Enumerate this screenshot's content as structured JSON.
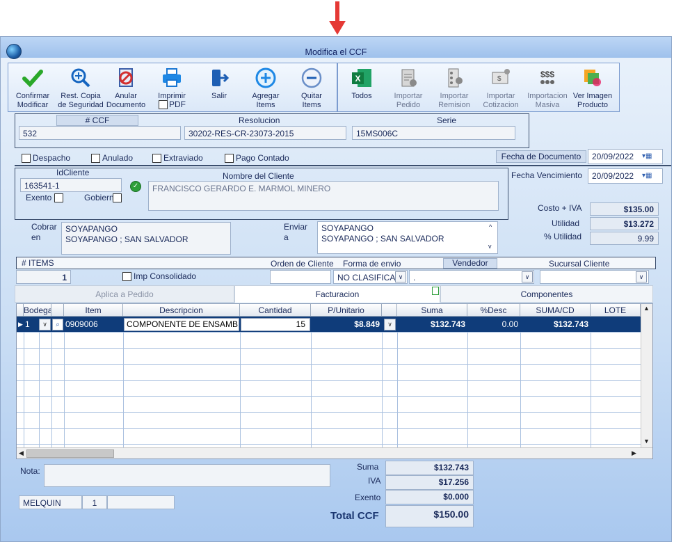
{
  "window": {
    "title": "Modifica el CCF"
  },
  "toolbar": {
    "confirmar": "Confirmar\nModificar",
    "rest": "Rest. Copia\nde Seguridad",
    "anular": "Anular\nDocumento",
    "imprimir": "Imprimir",
    "pdf": "PDF",
    "salir": "Salir",
    "agregar": "Agregar\nItems",
    "quitar": "Quitar\nItems",
    "todos": "Todos",
    "imp_pedido": "Importar\nPedido",
    "imp_remision": "Importar\nRemision",
    "imp_cotizacion": "Importar\nCotizacion",
    "imp_masiva": "Importacion\nMasiva",
    "ver_imagen": "Ver Imagen\nProducto"
  },
  "doc": {
    "ccf_label": "# CCF",
    "ccf": "532",
    "resolucion_label": "Resolucion",
    "resolucion": "30202-RES-CR-23073-2015",
    "serie_label": "Serie",
    "serie": "15MS006C"
  },
  "flags": {
    "despacho": "Despacho",
    "anulado": "Anulado",
    "extraviado": "Extraviado",
    "pago": "Pago Contado"
  },
  "dates": {
    "fecha_doc_label": "Fecha de  Documento",
    "fecha_doc": "20/09/2022",
    "fecha_venc_label": "Fecha Vencimiento",
    "fecha_venc": "20/09/2022"
  },
  "cliente": {
    "id_label": "IdCliente",
    "id": "163541-1",
    "exento": "Exento",
    "gobierno": "Gobierno",
    "nombre_label": "Nombre del Cliente",
    "nombre": "FRANCISCO GERARDO E. MARMOL MINERO",
    "cobrar_label": "Cobrar\nen",
    "cobrar": "SOYAPANGO\nSOYAPANGO ; SAN SALVADOR",
    "enviar_label": "Enviar\na",
    "enviar": "SOYAPANGO\nSOYAPANGO ; SAN SALVADOR"
  },
  "costos": {
    "costo_label": "Costo + IVA",
    "costo": "$135.00",
    "util_label": "Utilidad",
    "util": "$13.272",
    "putil_label": "% Utilidad",
    "putil": "9.99"
  },
  "items": {
    "label": "# ITEMS",
    "count": "1",
    "imp_cons": "Imp Consolidado",
    "orden_label": "Orden de Cliente",
    "forma_label": "Forma de envio",
    "forma": "NO CLASIFICAD",
    "vendedor_label": "Vendedor",
    "vendedor": ".",
    "sucursal_label": "Sucursal Cliente"
  },
  "tabs": [
    "Aplica a Pedido",
    "Facturacion",
    "Componentes"
  ],
  "grid": {
    "columns": [
      "Bodega",
      "Item",
      "Descripcion",
      "Cantidad",
      "P/Unitario",
      "Suma",
      "%Desc",
      "SUMA/CD",
      "LOTE"
    ],
    "row": {
      "bodega": "1",
      "item": "0909006",
      "descripcion": "COMPONENTE DE ENSAMBLAJE",
      "cantidad": "15",
      "punitario": "$8.849",
      "suma": "$132.743",
      "desc": "0.00",
      "sumacd": "$132.743",
      "lote": ""
    }
  },
  "footer": {
    "nota_label": "Nota:",
    "user": "MELQUIN",
    "user_n": "1",
    "suma_label": "Suma",
    "suma": "$132.743",
    "iva_label": "IVA",
    "iva": "$17.256",
    "exento_label": "Exento",
    "exento": "$0.000",
    "total_label": "Total CCF",
    "total": "$150.00"
  }
}
